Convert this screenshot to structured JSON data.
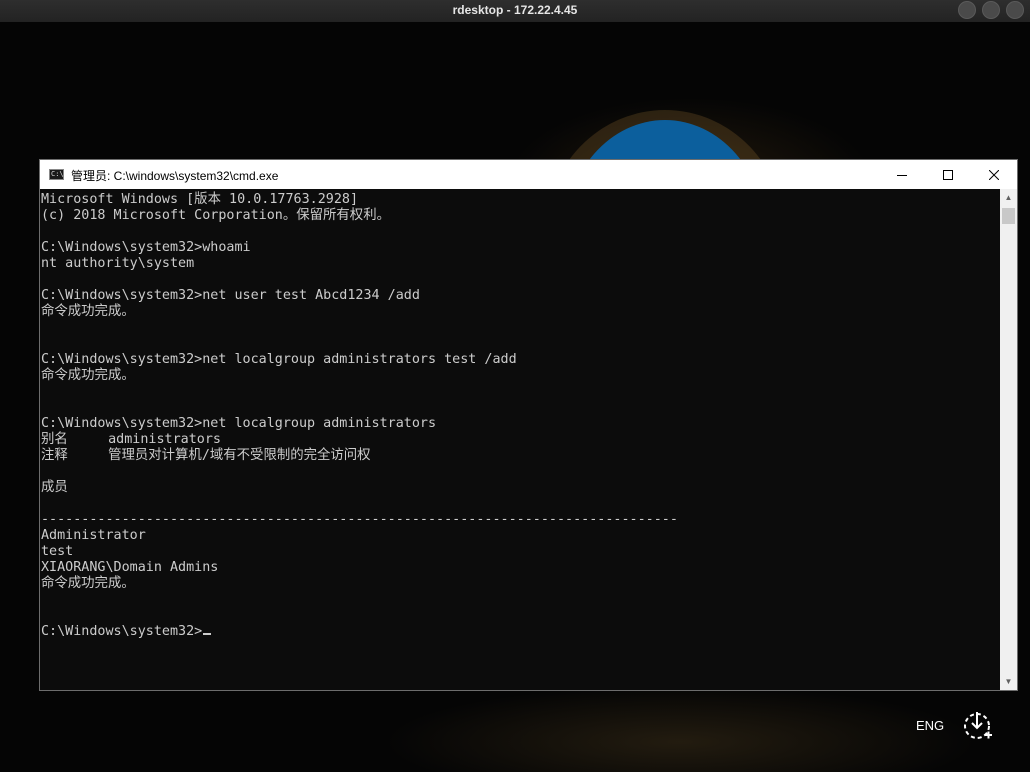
{
  "rdesktop": {
    "title": "rdesktop - 172.22.4.45"
  },
  "cmd": {
    "title": "管理员: C:\\windows\\system32\\cmd.exe",
    "icon": "cmd-icon",
    "icon_text": "C:\\",
    "lines": [
      "Microsoft Windows [版本 10.0.17763.2928]",
      "(c) 2018 Microsoft Corporation。保留所有权利。",
      "",
      "C:\\Windows\\system32>whoami",
      "nt authority\\system",
      "",
      "C:\\Windows\\system32>net user test Abcd1234 /add",
      "命令成功完成。",
      "",
      "",
      "C:\\Windows\\system32>net localgroup administrators test /add",
      "命令成功完成。",
      "",
      "",
      "C:\\Windows\\system32>net localgroup administrators",
      "别名     administrators",
      "注释     管理员对计算机/域有不受限制的完全访问权",
      "",
      "成员",
      "",
      "-------------------------------------------------------------------------------",
      "Administrator",
      "test",
      "XIAORANG\\Domain Admins",
      "命令成功完成。",
      "",
      "",
      "C:\\Windows\\system32>"
    ]
  },
  "tray": {
    "language": "ENG",
    "icon": "network-icon"
  }
}
